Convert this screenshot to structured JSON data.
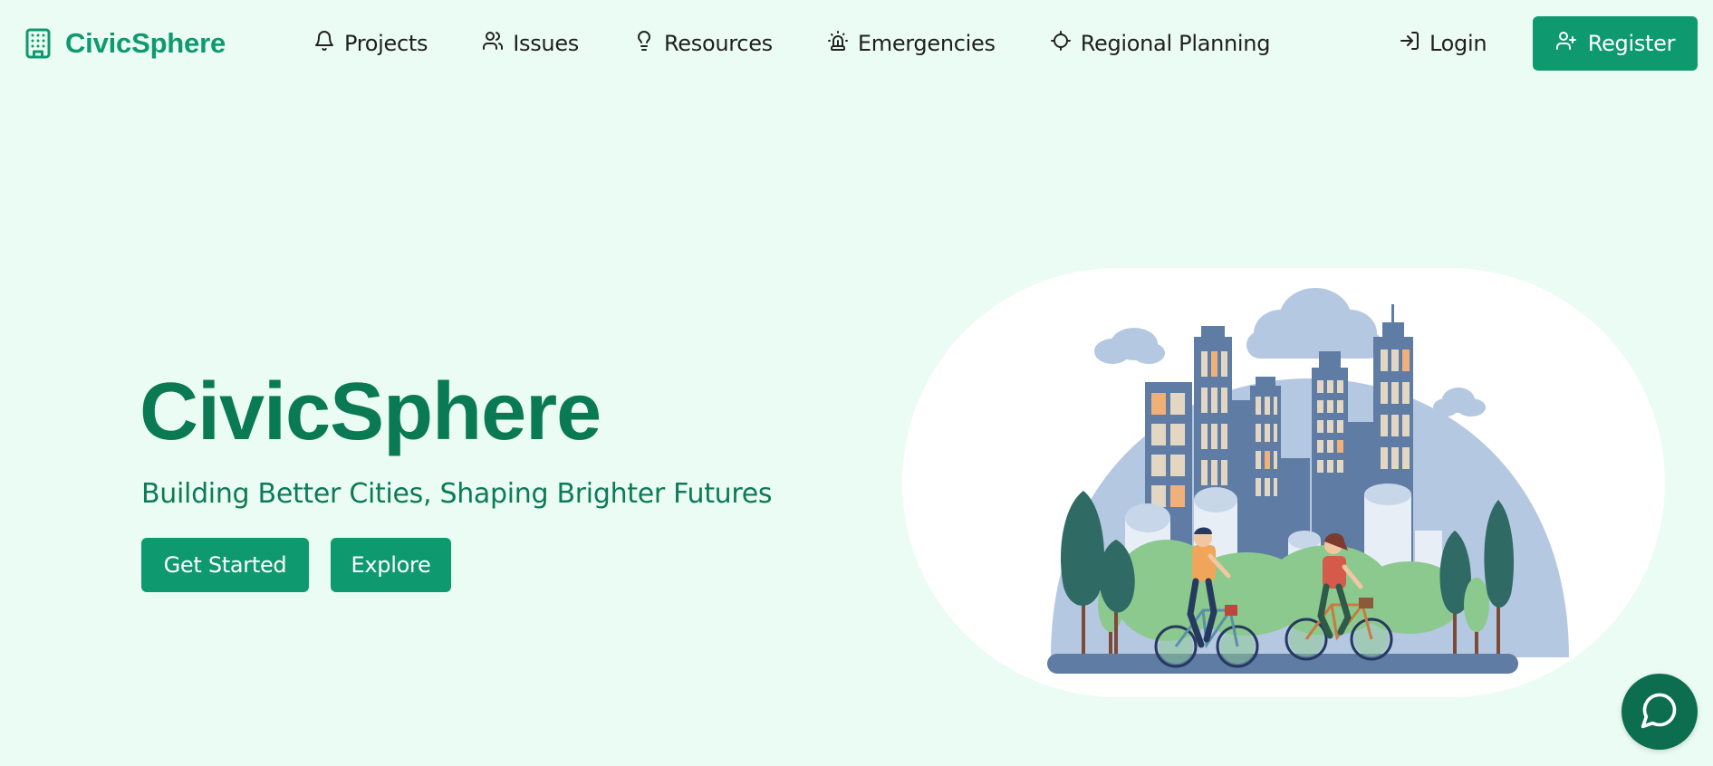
{
  "brand": {
    "name": "CivicSphere",
    "icon": "building-icon"
  },
  "nav": {
    "items": [
      {
        "label": "Projects",
        "icon": "bell-icon"
      },
      {
        "label": "Issues",
        "icon": "users-icon"
      },
      {
        "label": "Resources",
        "icon": "lightbulb-icon"
      },
      {
        "label": "Emergencies",
        "icon": "siren-icon"
      },
      {
        "label": "Regional Planning",
        "icon": "crosshair-icon"
      }
    ],
    "login_label": "Login",
    "register_label": "Register"
  },
  "hero": {
    "title": "CivicSphere",
    "subtitle": "Building Better Cities, Shaping Brighter Futures",
    "primary_button": "Get Started",
    "secondary_button": "Explore"
  },
  "illustration": {
    "subject": "city skyline with two cyclists and trees"
  },
  "chat": {
    "icon": "chat-bubble-icon"
  },
  "colors": {
    "accent": "#0e9a6e",
    "accent_dark": "#0a7a55",
    "background": "#ebfcf4",
    "chat_button": "#0d6e4f"
  }
}
